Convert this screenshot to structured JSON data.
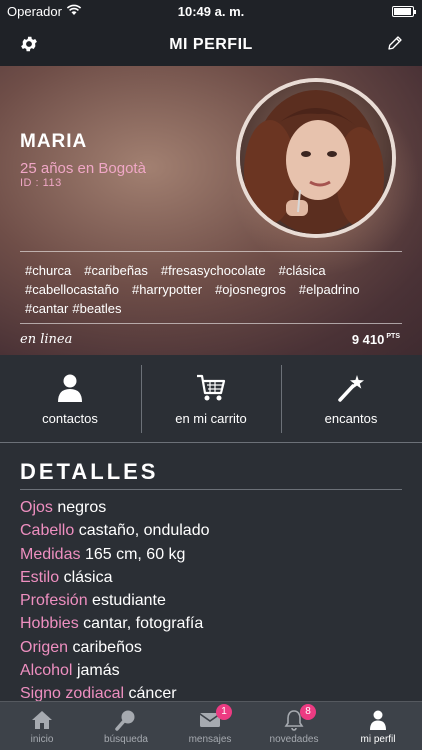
{
  "status": {
    "carrier": "Operador",
    "time": "10:49 a. m."
  },
  "nav": {
    "title": "MI PERFIL"
  },
  "profile": {
    "name": "MARIA",
    "location": "25 años en Bogotà",
    "id": "ID : 113",
    "tags": [
      "#churca",
      "#caribeñas",
      "#fresasychocolate",
      "#clásica",
      "#cabellocastaño",
      "#harrypotter",
      "#ojosnegros",
      "#elpadrino",
      "#cantar",
      "#beatles"
    ],
    "online": "en linea",
    "points": "9 410",
    "points_unit": "PTS"
  },
  "actions": [
    {
      "label": "contactos",
      "icon": "person-icon"
    },
    {
      "label": "en mi carrito",
      "icon": "cart-icon"
    },
    {
      "label": "encantos",
      "icon": "magic-wand-icon"
    }
  ],
  "details": {
    "title": "DETALLES",
    "rows": [
      {
        "key": "Ojos",
        "value": "negros"
      },
      {
        "key": "Cabello",
        "value": "castaño, ondulado"
      },
      {
        "key": "Medidas",
        "value": "165 cm, 60 kg"
      },
      {
        "key": "Estilo",
        "value": "clásica"
      },
      {
        "key": "Profesión",
        "value": "estudiante"
      },
      {
        "key": "Hobbies",
        "value": "cantar, fotografía"
      },
      {
        "key": "Origen",
        "value": "caribeños"
      },
      {
        "key": "Alcohol",
        "value": "jamás"
      },
      {
        "key": "Signo zodiacal",
        "value": "cáncer"
      }
    ]
  },
  "tabs": [
    {
      "label": "inicio",
      "icon": "home-icon"
    },
    {
      "label": "búsqueda",
      "icon": "search-icon"
    },
    {
      "label": "mensajes",
      "icon": "envelope-icon",
      "badge": "1"
    },
    {
      "label": "novedades",
      "icon": "bell-icon",
      "badge": "8"
    },
    {
      "label": "mi perfil",
      "icon": "profile-icon"
    }
  ],
  "colors": {
    "accent": "#ee8fc0",
    "badge": "#ec3b82",
    "background": "#2b2f35"
  }
}
